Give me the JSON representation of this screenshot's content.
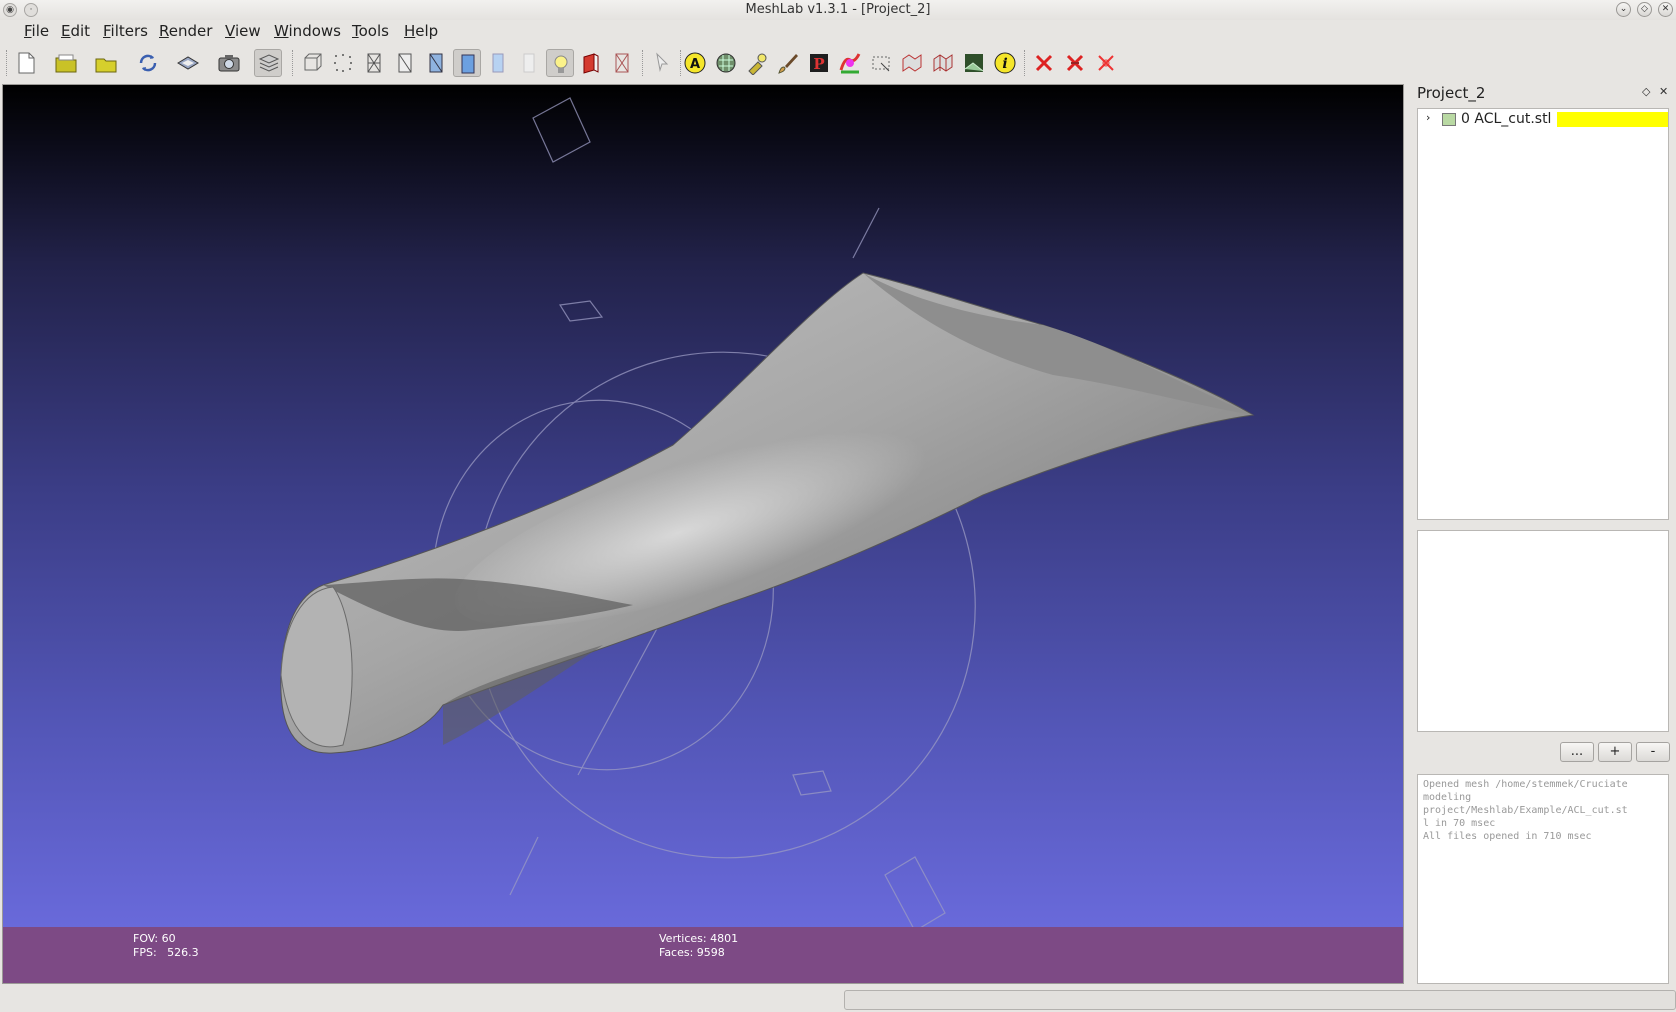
{
  "window": {
    "title": "MeshLab v1.3.1 - [Project_2]"
  },
  "menu": {
    "items": [
      {
        "label": "File"
      },
      {
        "label": "Edit"
      },
      {
        "label": "Filters"
      },
      {
        "label": "Render"
      },
      {
        "label": "View"
      },
      {
        "label": "Windows"
      },
      {
        "label": "Tools"
      },
      {
        "label": "Help"
      }
    ]
  },
  "viewport": {
    "info": {
      "fov": "FOV: 60",
      "fps": "FPS:   526.3",
      "vertices": "Vertices: 4801",
      "faces": "Faces: 9598"
    }
  },
  "panel": {
    "title": "Project_2",
    "float_icon": "◇",
    "close_icon": "✕",
    "layers": [
      {
        "expand": "›",
        "name": "0  ACL_cut.stl"
      }
    ],
    "buttons": {
      "more": "...",
      "add": "+",
      "remove": "-"
    },
    "log": [
      "Opened mesh /home/stemmek/Cruciate",
      "modeling",
      "project/Meshlab/Example/ACL_cut.st",
      "l in 70 msec",
      "All files opened in 710 msec"
    ]
  },
  "colors": {
    "info_bar": "#7d4a85",
    "selection": "#ffff00",
    "mesh": "#9a9a9a"
  }
}
